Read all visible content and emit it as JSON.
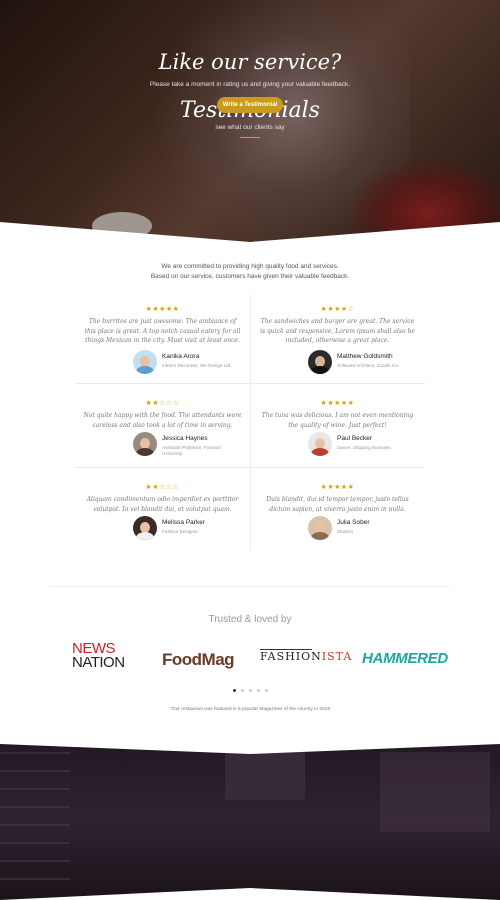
{
  "hero": {
    "title": "Testimonials",
    "subtitle": "see what our clients say"
  },
  "intro": {
    "line1": "We are committed to providing high quality food and services.",
    "line2": "Based on our service, customers have given their valuable feedback."
  },
  "testimonials": [
    {
      "stars": "★★★★★",
      "rating": 5,
      "quote": "The burritos are just awesome. The ambiance of this place is great. A top notch casual eatery for all things Mexican in the city. Must visit at least once.",
      "name": "Kanika Arora",
      "role": "Interior Decorator, We Design Ltd."
    },
    {
      "stars": "★★★★☆",
      "rating": 4,
      "quote": "The sandwiches and burger are great. The service is quick and responsive. Lorem ipsum shall also be included, otherwise a great place.",
      "name": "Matthew Goldsmith",
      "role": "Software Architect, Zoodle Inc."
    },
    {
      "stars": "★★☆☆☆",
      "rating": 2,
      "quote": "Not quite happy with the food. The attendants were careless and also took a lot of time in serving.",
      "name": "Jessica Haynes",
      "role": "Assistant Professor, Forward University"
    },
    {
      "stars": "★★★★★",
      "rating": 5,
      "quote": "The tuna was delicious. I am not even mentioning the quality of wine. Just perfect!",
      "name": "Paul Becker",
      "role": "Owner, Shipping Business"
    },
    {
      "stars": "★★☆☆☆",
      "rating": 2,
      "quote": "Aliquam condimentum odio imperdiet ex porttitor volutpat. In vel blandit dui, et volutpat quam.",
      "name": "Melissa Parker",
      "role": "Fashion Designer"
    },
    {
      "stars": "★★★★★",
      "rating": 5,
      "quote": "Duis blandit, dui id tempor tempor, justo tellus dictum sapien, at viverra justo enim in nulla.",
      "name": "Julia Sober",
      "role": "Student"
    }
  ],
  "trusted": {
    "heading": "Trusted & loved by",
    "logos": {
      "news_line1": "NEWS",
      "news_line2": "NATION",
      "foodmag": "FoodMag",
      "fashion_main": "FASHION",
      "fashion_accent": "ISTA",
      "hammered": "HAMMERED"
    },
    "carousel_pages": 5,
    "carousel_active": 1,
    "footnote": "*Our restaurant was featured in 5 popular Magazines of the country in 2018"
  },
  "cta": {
    "title": "Like our service?",
    "subtitle": "Please take a moment in rating us and giving your valuable feedback.",
    "button_label": "Write a Testimonial"
  },
  "colors": {
    "accent": "#c99a1d",
    "star": "#d4a017",
    "news_red": "#d21f26",
    "hammered_teal": "#1fa79d",
    "foodmag_brown": "#6b3a25"
  }
}
